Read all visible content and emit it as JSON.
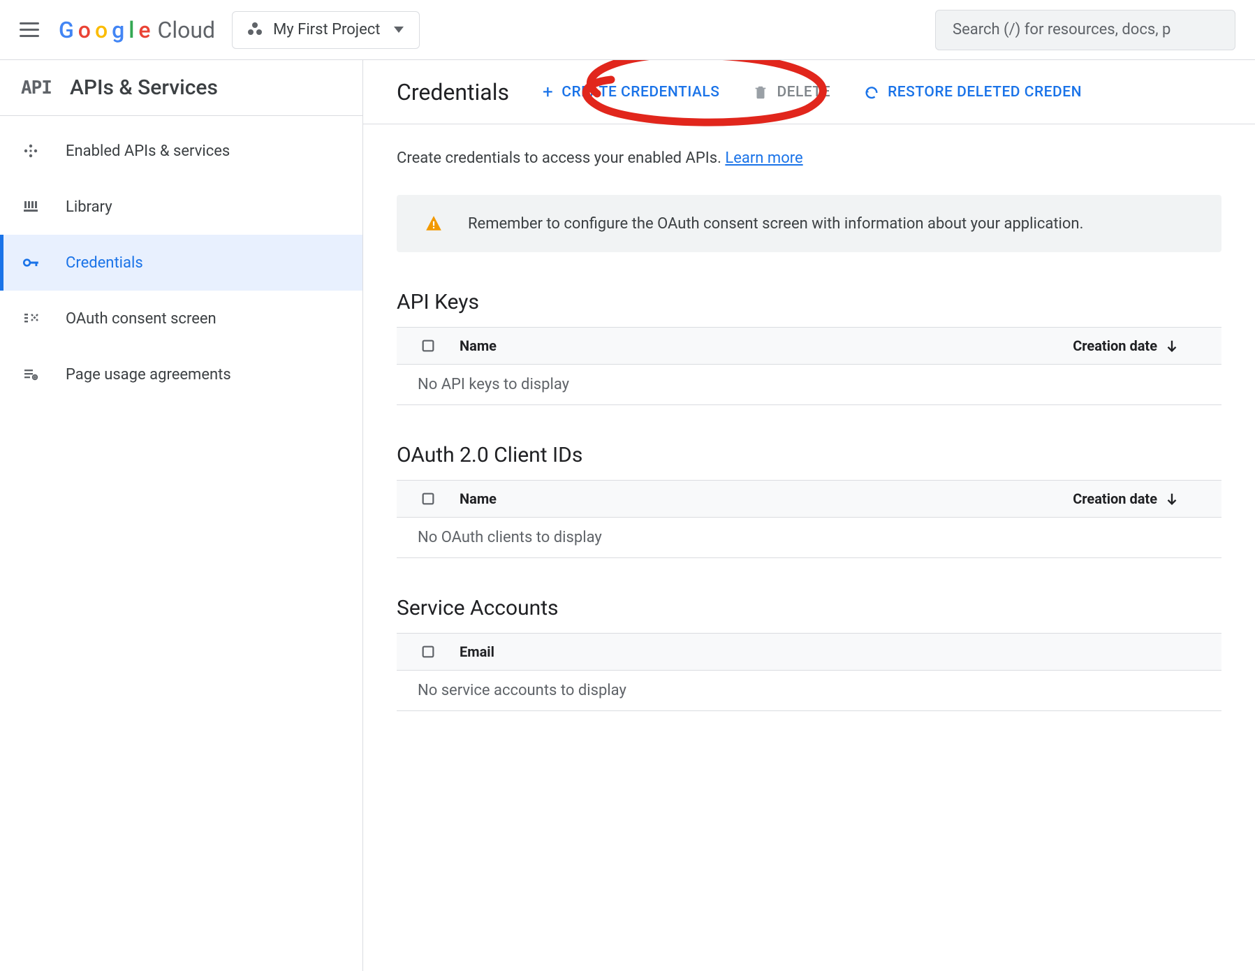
{
  "header": {
    "logo_text": "Cloud",
    "project_name": "My First Project",
    "search_placeholder": "Search (/) for resources, docs, p"
  },
  "sidebar": {
    "title": "APIs & Services",
    "items": [
      {
        "icon": "diamond-icon",
        "label": "Enabled APIs & services"
      },
      {
        "icon": "library-icon",
        "label": "Library"
      },
      {
        "icon": "key-icon",
        "label": "Credentials"
      },
      {
        "icon": "consent-icon",
        "label": "OAuth consent screen"
      },
      {
        "icon": "agreement-icon",
        "label": "Page usage agreements"
      }
    ]
  },
  "main": {
    "title": "Credentials",
    "create_label": "CREATE CREDENTIALS",
    "delete_label": "DELETE",
    "restore_label": "RESTORE DELETED CREDEN",
    "subtext": "Create credentials to access your enabled APIs.",
    "learn_more": "Learn more",
    "alert": "Remember to configure the OAuth consent screen with information about your application.",
    "sections": {
      "api_keys": {
        "title": "API Keys",
        "col_name": "Name",
        "col_date": "Creation date",
        "empty": "No API keys to display"
      },
      "oauth": {
        "title": "OAuth 2.0 Client IDs",
        "col_name": "Name",
        "col_date": "Creation date",
        "empty": "No OAuth clients to display"
      },
      "service": {
        "title": "Service Accounts",
        "col_email": "Email",
        "empty": "No service accounts to display"
      }
    }
  }
}
